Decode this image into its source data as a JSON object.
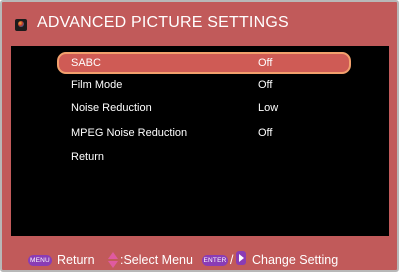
{
  "header": {
    "title": "ADVANCED PICTURE SETTINGS",
    "icon": "tv-icon"
  },
  "menu": {
    "items": [
      {
        "label": "SABC",
        "value": "Off",
        "selected": true
      },
      {
        "label": "Film Mode",
        "value": "Off",
        "selected": false
      },
      {
        "label": "Noise Reduction",
        "value": "Low",
        "selected": false
      },
      {
        "label": "MPEG Noise Reduction",
        "value": "Off",
        "selected": false
      },
      {
        "label": "Return",
        "value": "",
        "selected": false
      }
    ]
  },
  "footer": {
    "menu_key": "MENU",
    "return_label": "Return",
    "select_label": ":Select Menu",
    "enter_key": "ENTER",
    "slash": "/",
    "change_label": "Change Setting"
  },
  "colors": {
    "frame": "#c15a5a",
    "panel": "#000000",
    "highlight": "#cf5b55",
    "highlight_border": "#f2a06d",
    "key_purple": "#8a3cb5",
    "arrow_pink": "#e05aa0"
  }
}
